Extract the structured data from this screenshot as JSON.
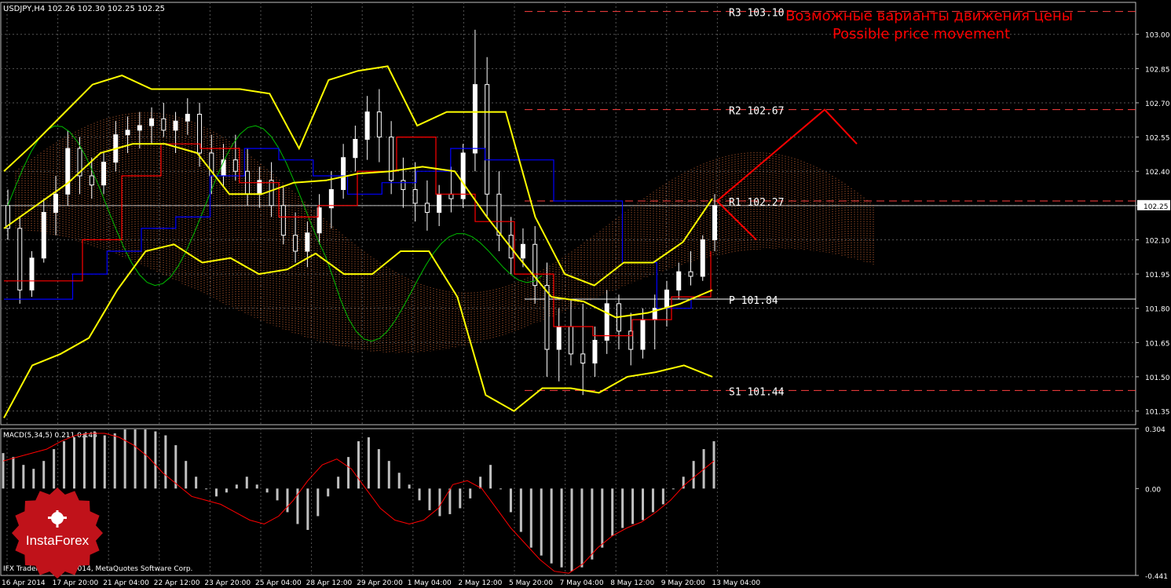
{
  "header": {
    "symbol_info": "USDJPY,H4  102.26 102.30 102.25 102.25",
    "macd_label": "MACD(5,34,5) 0.211 0.148",
    "footer": "IFX Trader, © 2001-2014, MetaQuotes Software Corp."
  },
  "annotation": {
    "line1": "Возможные варианты движения цены",
    "line2": "Possible price movement"
  },
  "logo": {
    "text": "InstaForex",
    "color": "#c0121a"
  },
  "colors": {
    "background": "#000000",
    "candle_up": "#ffffff",
    "candle_down": "#000000",
    "bollinger": "#ffff00",
    "kijun": "#0000ff",
    "tenkan": "#ff0000",
    "chikou": "#00c000",
    "cloud": "#ff8040",
    "levels": "#ff4040",
    "forecast": "#ff0000",
    "macd_hist": "#c0c0c0",
    "macd_signal": "#ff0000"
  },
  "chart_data": [
    {
      "type": "candlestick",
      "symbol": "USDJPY",
      "timeframe": "H4",
      "ylim": [
        101.29,
        103.14
      ],
      "yticks": [
        103.0,
        102.85,
        102.7,
        102.55,
        102.4,
        102.25,
        102.1,
        101.95,
        101.8,
        101.65,
        101.5,
        101.35
      ],
      "ytick_labels": [
        "103.00",
        "102.85",
        "102.70",
        "102.55",
        "102.40",
        "102.25",
        "102.10",
        "101.95",
        "101.80",
        "101.65",
        "101.50",
        "101.35"
      ],
      "current_price": "102.25",
      "xtick_labels": [
        "16 Apr 2014",
        "17 Apr 20:00",
        "21 Apr 04:00",
        "22 Apr 12:00",
        "23 Apr 20:00",
        "25 Apr 04:00",
        "28 Apr 12:00",
        "29 Apr 20:00",
        "1 May 04:00",
        "2 May 12:00",
        "5 May 20:00",
        "7 May 04:00",
        "8 May 12:00",
        "9 May 20:00",
        "13 May 04:00"
      ],
      "levels": [
        {
          "label": "R3",
          "value": 103.1,
          "text": "103.10"
        },
        {
          "label": "R2",
          "value": 102.67,
          "text": "102.67"
        },
        {
          "label": "R1",
          "value": 102.27,
          "text": "102.27"
        },
        {
          "label": "P",
          "value": 101.84,
          "text": "101.84"
        },
        {
          "label": "S1",
          "value": 101.44,
          "text": "101.44"
        }
      ],
      "bollinger_upper": [
        102.4,
        102.52,
        102.65,
        102.78,
        102.82,
        102.76,
        102.76,
        102.76,
        102.76,
        102.74,
        102.5,
        102.8,
        102.84,
        102.86,
        102.6,
        102.66,
        102.66,
        102.66,
        102.2,
        101.95,
        101.9,
        102.0,
        102.0,
        102.09,
        102.28
      ],
      "bollinger_mid": [
        102.15,
        102.25,
        102.35,
        102.48,
        102.52,
        102.52,
        102.48,
        102.3,
        102.3,
        102.35,
        102.36,
        102.39,
        102.4,
        102.42,
        102.4,
        102.2,
        102.02,
        101.85,
        101.83,
        101.76,
        101.78,
        101.82,
        101.88
      ],
      "bollinger_lower": [
        101.32,
        101.55,
        101.6,
        101.67,
        101.88,
        102.05,
        102.08,
        102.0,
        102.02,
        101.95,
        101.97,
        102.04,
        101.95,
        101.95,
        102.05,
        102.05,
        101.85,
        101.42,
        101.35,
        101.45,
        101.45,
        101.43,
        101.5,
        101.52,
        101.55,
        101.5
      ],
      "forecast": [
        [
          102.27,
          102.67,
          102.52
        ],
        [
          102.27,
          102.1
        ]
      ],
      "candles_ohlc": [
        [
          102.25,
          102.32,
          102.1,
          102.15
        ],
        [
          102.15,
          102.2,
          101.82,
          101.88
        ],
        [
          101.88,
          102.05,
          101.85,
          102.02
        ],
        [
          102.02,
          102.28,
          102.0,
          102.22
        ],
        [
          102.22,
          102.38,
          102.12,
          102.3
        ],
        [
          102.3,
          102.58,
          102.25,
          102.5
        ],
        [
          102.5,
          102.55,
          102.3,
          102.38
        ],
        [
          102.38,
          102.46,
          102.28,
          102.34
        ],
        [
          102.34,
          102.48,
          102.3,
          102.44
        ],
        [
          102.44,
          102.62,
          102.4,
          102.56
        ],
        [
          102.56,
          102.64,
          102.48,
          102.58
        ],
        [
          102.58,
          102.66,
          102.5,
          102.6
        ],
        [
          102.6,
          102.68,
          102.52,
          102.63
        ],
        [
          102.63,
          102.7,
          102.55,
          102.58
        ],
        [
          102.58,
          102.66,
          102.48,
          102.62
        ],
        [
          102.62,
          102.72,
          102.56,
          102.65
        ],
        [
          102.65,
          102.7,
          102.42,
          102.48
        ],
        [
          102.48,
          102.56,
          102.3,
          102.38
        ],
        [
          102.38,
          102.52,
          102.33,
          102.45
        ],
        [
          102.45,
          102.56,
          102.36,
          102.4
        ],
        [
          102.4,
          102.5,
          102.25,
          102.3
        ],
        [
          102.3,
          102.42,
          102.24,
          102.36
        ],
        [
          102.36,
          102.44,
          102.2,
          102.25
        ],
        [
          102.25,
          102.33,
          102.08,
          102.12
        ],
        [
          102.12,
          102.22,
          102.0,
          102.05
        ],
        [
          102.05,
          102.18,
          101.98,
          102.13
        ],
        [
          102.13,
          102.3,
          102.08,
          102.24
        ],
        [
          102.24,
          102.4,
          102.15,
          102.32
        ],
        [
          102.32,
          102.52,
          102.28,
          102.46
        ],
        [
          102.46,
          102.6,
          102.4,
          102.54
        ],
        [
          102.54,
          102.73,
          102.45,
          102.66
        ],
        [
          102.66,
          102.76,
          102.44,
          102.55
        ],
        [
          102.55,
          102.62,
          102.3,
          102.36
        ],
        [
          102.36,
          102.46,
          102.24,
          102.32
        ],
        [
          102.32,
          102.44,
          102.18,
          102.26
        ],
        [
          102.26,
          102.36,
          102.14,
          102.22
        ],
        [
          102.22,
          102.34,
          102.16,
          102.3
        ],
        [
          102.3,
          102.42,
          102.22,
          102.28
        ],
        [
          102.28,
          102.52,
          102.24,
          102.48
        ],
        [
          102.48,
          103.02,
          102.4,
          102.78
        ],
        [
          102.78,
          102.9,
          102.2,
          102.3
        ],
        [
          102.3,
          102.4,
          102.05,
          102.12
        ],
        [
          102.12,
          102.2,
          101.95,
          102.02
        ],
        [
          102.02,
          102.15,
          101.98,
          102.08
        ],
        [
          102.08,
          102.16,
          101.82,
          101.9
        ],
        [
          101.9,
          102.0,
          101.5,
          101.62
        ],
        [
          101.62,
          101.8,
          101.48,
          101.72
        ],
        [
          101.72,
          101.84,
          101.55,
          101.6
        ],
        [
          101.6,
          101.82,
          101.42,
          101.56
        ],
        [
          101.56,
          101.72,
          101.5,
          101.66
        ],
        [
          101.66,
          101.88,
          101.6,
          101.82
        ],
        [
          101.82,
          101.86,
          101.62,
          101.7
        ],
        [
          101.7,
          101.78,
          101.55,
          101.62
        ],
        [
          101.62,
          101.8,
          101.58,
          101.75
        ],
        [
          101.75,
          101.86,
          101.62,
          101.8
        ],
        [
          101.8,
          101.92,
          101.72,
          101.88
        ],
        [
          101.88,
          102.0,
          101.84,
          101.96
        ],
        [
          101.96,
          102.05,
          101.9,
          101.94
        ],
        [
          101.94,
          102.12,
          101.92,
          102.1
        ],
        [
          102.1,
          102.3,
          102.05,
          102.25
        ]
      ]
    },
    {
      "type": "bar",
      "name": "MACD(5,34,5)",
      "ylim": [
        -0.441,
        0.304
      ],
      "ytick_labels": [
        "0.304",
        "0.00",
        "-0.441"
      ],
      "values": [
        0.18,
        0.16,
        0.12,
        0.1,
        0.14,
        0.2,
        0.24,
        0.26,
        0.28,
        0.29,
        0.27,
        0.28,
        0.3,
        0.3,
        0.3,
        0.29,
        0.27,
        0.22,
        0.14,
        0.06,
        0.0,
        -0.04,
        -0.02,
        0.02,
        0.06,
        0.02,
        -0.02,
        -0.06,
        -0.12,
        -0.18,
        -0.21,
        -0.14,
        -0.04,
        0.06,
        0.16,
        0.24,
        0.26,
        0.2,
        0.14,
        0.08,
        0.02,
        -0.06,
        -0.11,
        -0.14,
        -0.13,
        -0.1,
        -0.05,
        0.06,
        0.12,
        0.0,
        -0.12,
        -0.22,
        -0.3,
        -0.34,
        -0.38,
        -0.4,
        -0.42,
        -0.4,
        -0.36,
        -0.3,
        -0.24,
        -0.2,
        -0.18,
        -0.16,
        -0.12,
        -0.08,
        0.0,
        0.06,
        0.14,
        0.2,
        0.24
      ],
      "signal": [
        0.14,
        0.16,
        0.18,
        0.2,
        0.24,
        0.27,
        0.28,
        0.28,
        0.26,
        0.22,
        0.16,
        0.08,
        0.02,
        -0.04,
        -0.06,
        -0.08,
        -0.12,
        -0.16,
        -0.18,
        -0.14,
        -0.06,
        0.04,
        0.12,
        0.15,
        0.1,
        0.0,
        -0.1,
        -0.16,
        -0.18,
        -0.16,
        -0.1,
        0.02,
        0.04,
        0.0,
        -0.1,
        -0.2,
        -0.28,
        -0.36,
        -0.42,
        -0.43,
        -0.38,
        -0.3,
        -0.24,
        -0.2,
        -0.17,
        -0.12,
        -0.06,
        0.02,
        0.08,
        0.14
      ]
    }
  ]
}
